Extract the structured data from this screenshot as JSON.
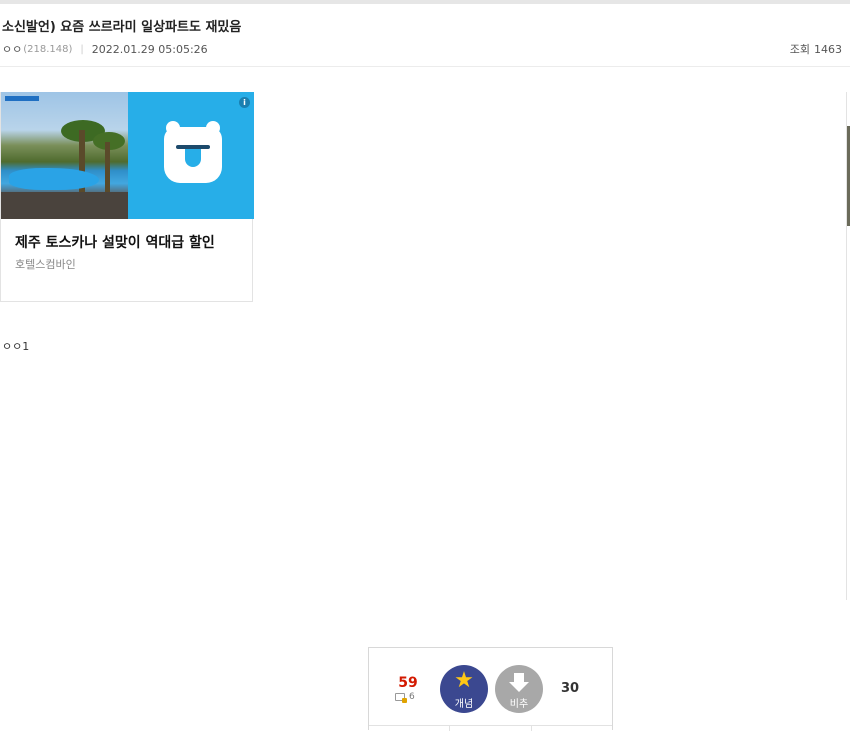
{
  "post": {
    "title": "소신발언) 요즘 쓰르라미 일상파트도 재밌음",
    "author": "ㅇㅇ",
    "ip": "(218.148)",
    "separator": "|",
    "date": "2022.01.29 05:05:26",
    "views_label": "조회",
    "views_count": "1463",
    "body": "ㅇㅇ1"
  },
  "ad": {
    "title": "제주 토스카나 설맞이 역대급 할인",
    "advertiser": "호텔스컴바인",
    "info_label": "i",
    "brand_color": "#27aee8"
  },
  "recommend": {
    "up_count": "59",
    "fixed_count": "6",
    "up_label": "개념",
    "down_label": "비추",
    "down_count": "30",
    "up_icon": "star-icon",
    "down_icon": "down-arrow-icon",
    "up_color": "#3b4890",
    "down_color": "#a8a8a8",
    "up_count_color": "#d31900"
  }
}
